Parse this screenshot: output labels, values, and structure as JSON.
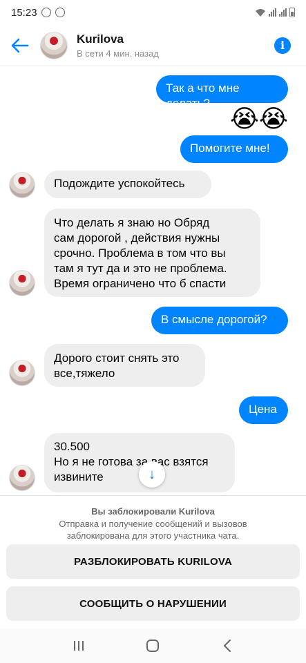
{
  "status_bar": {
    "time": "15:23"
  },
  "header": {
    "name": "Kurilova",
    "status": "В сети 4 мин. назад",
    "info_glyph": "i"
  },
  "messages": [
    {
      "from": "me",
      "text": "Так а что мне делать?"
    },
    {
      "from": "me",
      "type": "emoji",
      "text": "😭😭"
    },
    {
      "from": "me",
      "text": "Помогите мне!"
    },
    {
      "from": "them",
      "text": "Подождите успокойтесь"
    },
    {
      "from": "them",
      "lines": [
        "Что делать я знаю но Обряд",
        "сам дорогой , действия нужны",
        "срочно. Проблема в том что вы",
        "там я тут да и это не проблема.",
        "Время ограничено что б спасти"
      ]
    },
    {
      "from": "me",
      "text": "В смысле дорогой?"
    },
    {
      "from": "them",
      "lines": [
        "Дорого стоит снять это",
        "все,тяжело"
      ]
    },
    {
      "from": "me",
      "text": "Цена"
    },
    {
      "from": "them",
      "lines": [
        "30.500",
        "Но я не готова за вас взятся",
        "извините"
      ]
    }
  ],
  "scroll_down_glyph": "↓",
  "blocked": {
    "title": "Вы заблокировали Kurilova",
    "description": "Отправка и получение сообщений и вызовов заблокирована для этого участника чата."
  },
  "buttons": {
    "unblock": "РАЗБЛОКИРОВАТЬ KURILOVA",
    "report": "СООБЩИТЬ О НАРУШЕНИИ"
  },
  "colors": {
    "accent": "#0084ff",
    "incoming_bubble": "#eeeeef"
  },
  "icons": [
    "back-arrow-icon",
    "info-icon",
    "recent-apps-icon",
    "home-icon",
    "back-nav-icon"
  ]
}
